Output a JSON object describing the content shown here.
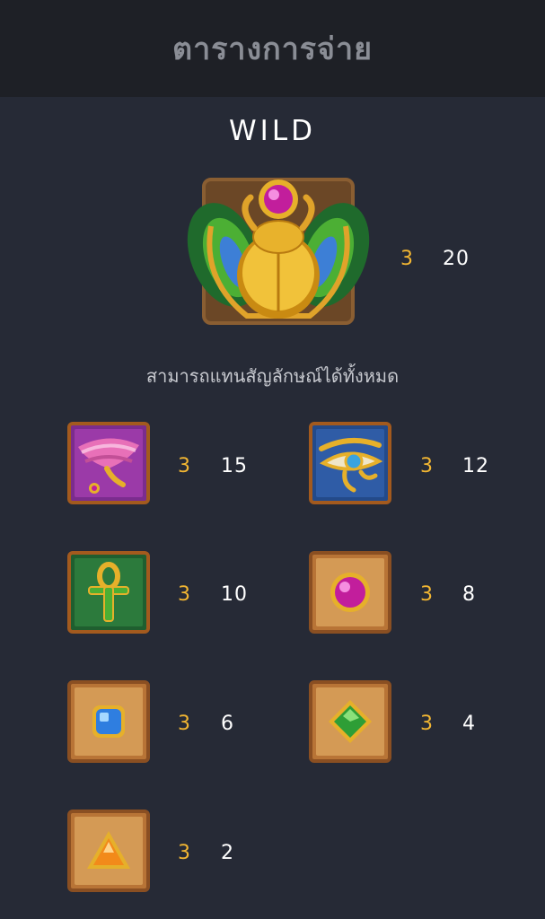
{
  "header": {
    "title": "ตารางการจ่าย"
  },
  "wild": {
    "title": "WILD",
    "icon": "golden-scarab-icon",
    "count": "3",
    "payout": "20",
    "description": "สามารถแทนสัญลักษณ์ได้ทั้งหมด"
  },
  "symbols": [
    {
      "icon": "winged-scarab-icon",
      "count": "3",
      "payout": "15"
    },
    {
      "icon": "eye-of-horus-icon",
      "count": "3",
      "payout": "12"
    },
    {
      "icon": "ankh-icon",
      "count": "3",
      "payout": "10"
    },
    {
      "icon": "pink-gem-icon",
      "count": "3",
      "payout": "8"
    },
    {
      "icon": "blue-gem-icon",
      "count": "3",
      "payout": "6"
    },
    {
      "icon": "green-diamond-icon",
      "count": "3",
      "payout": "4"
    },
    {
      "icon": "orange-triangle-icon",
      "count": "3",
      "payout": "2"
    }
  ],
  "colors": {
    "background": "#262a36",
    "header": "#1e2026",
    "count": "#f2b632",
    "payout": "#ffffff"
  }
}
